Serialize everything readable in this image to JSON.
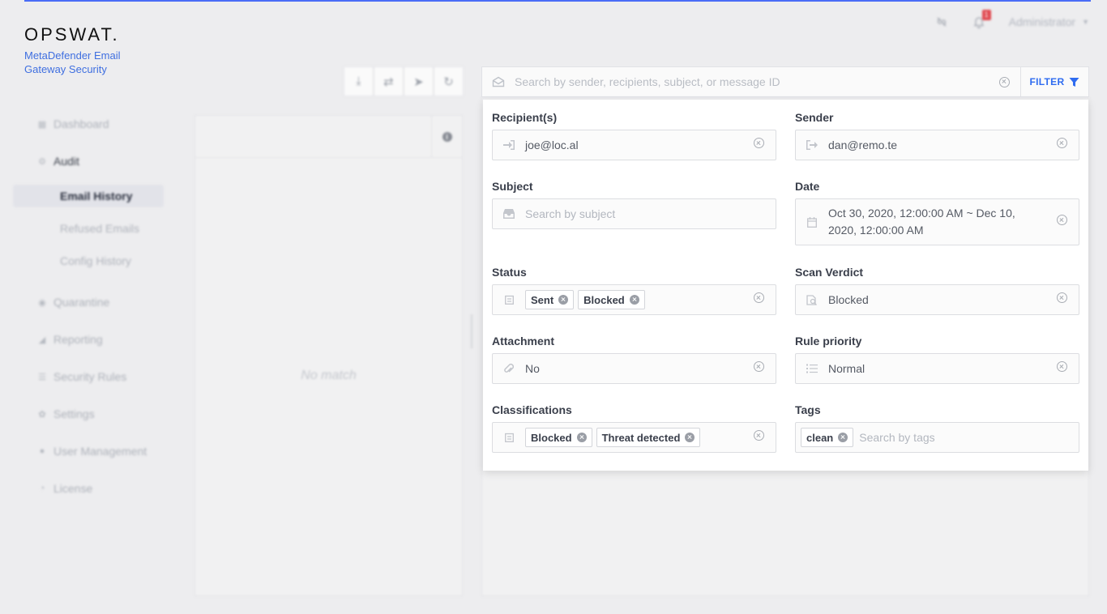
{
  "brand": {
    "logo": "OPSWAT.",
    "product": "MetaDefender Email Gateway Security"
  },
  "header": {
    "notification_count": "1",
    "user": "Administrator"
  },
  "sidebar": {
    "items": [
      {
        "label": "Dashboard",
        "icon": "dashboard-icon"
      },
      {
        "label": "Audit",
        "icon": "audit-icon"
      },
      {
        "label": "Quarantine",
        "icon": "quarantine-icon"
      },
      {
        "label": "Reporting",
        "icon": "reporting-icon"
      },
      {
        "label": "Security Rules",
        "icon": "security-rules-icon"
      },
      {
        "label": "Settings",
        "icon": "gear-icon"
      },
      {
        "label": "User Management",
        "icon": "user-icon"
      },
      {
        "label": "License",
        "icon": "license-icon"
      }
    ],
    "audit_sub": [
      {
        "label": "Email History",
        "active": true
      },
      {
        "label": "Refused Emails",
        "active": false
      },
      {
        "label": "Config History",
        "active": false
      }
    ]
  },
  "list": {
    "empty_text": "No match"
  },
  "search": {
    "placeholder": "Search by sender, recipients, subject, or message ID",
    "filter_label": "FILTER"
  },
  "filters": {
    "recipients": {
      "label": "Recipient(s)",
      "value": "joe@loc.al"
    },
    "sender": {
      "label": "Sender",
      "value": "dan@remo.te"
    },
    "subject": {
      "label": "Subject",
      "placeholder": "Search by subject"
    },
    "date": {
      "label": "Date",
      "value": "Oct 30, 2020, 12:00:00 AM ~ Dec 10, 2020, 12:00:00 AM"
    },
    "status": {
      "label": "Status",
      "tags": [
        "Sent",
        "Blocked"
      ]
    },
    "scan_verdict": {
      "label": "Scan Verdict",
      "value": "Blocked"
    },
    "attachment": {
      "label": "Attachment",
      "value": "No"
    },
    "rule_priority": {
      "label": "Rule priority",
      "value": "Normal"
    },
    "classifications": {
      "label": "Classifications",
      "tags": [
        "Blocked",
        "Threat detected"
      ]
    },
    "tags": {
      "label": "Tags",
      "tags": [
        "clean"
      ],
      "placeholder": "Search by tags"
    }
  },
  "colors": {
    "accent": "#2f6cf0",
    "badge": "#e0484f"
  }
}
